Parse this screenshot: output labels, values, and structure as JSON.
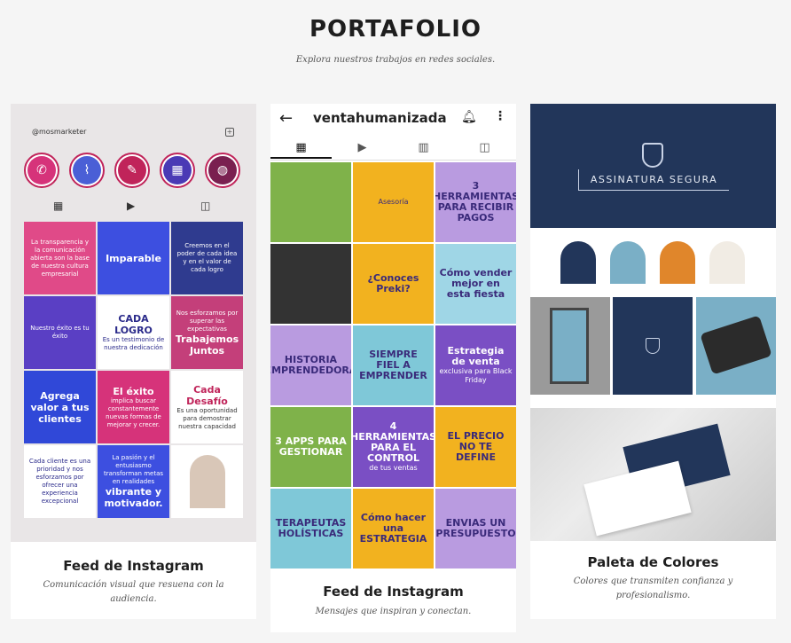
{
  "header": {
    "title": "PORTAFOLIO",
    "subtitle": "Explora nuestros trabajos en redes sociales."
  },
  "card1": {
    "handle": "@mosmarketer",
    "highlight_colors": [
      "#d6337a",
      "#4a5fd6",
      "#c0245a",
      "#4a3ab5",
      "#7a2050"
    ],
    "tiles": [
      {
        "bg": "#e04a88",
        "text": "La transparencia y la comunicación abierta son la base de nuestra cultura empresarial"
      },
      {
        "bg": "#3d4fe0",
        "text": "Imparable"
      },
      {
        "bg": "#2f3b8f",
        "text": "Creemos en el poder de cada idea y en el valor de cada logro"
      },
      {
        "bg": "#5a3fc4",
        "text": "Nuestro éxito es tu éxito"
      },
      {
        "bg": "#ffffff",
        "title": "CADA LOGRO",
        "text": "Es un testimonio de nuestra dedicación"
      },
      {
        "bg": "#c43f7a",
        "text": "Nos esforzamos por superar las expectativas",
        "title": "Trabajemos Juntos"
      },
      {
        "bg": "#3048d8",
        "title": "Agrega valor a tus clientes"
      },
      {
        "bg": "#d6337a",
        "title": "El éxito",
        "text": "implica buscar constantemente nuevas formas de mejorar y crecer."
      },
      {
        "bg": "#ffffff",
        "title": "Cada Desafío",
        "text": "Es una oportunidad para demostrar nuestra capacidad"
      },
      {
        "bg": "#ffffff",
        "text": "Cada cliente es una prioridad y nos esforzamos por ofrecer una experiencia excepcional"
      },
      {
        "bg": "#3d4fe0",
        "text": "La pasión y el entusiasmo transforman metas en realidades",
        "title": "vibrante y motivador."
      },
      {
        "bg": "#ffffff",
        "text": ""
      }
    ],
    "caption_title": "Feed de Instagram",
    "caption_desc": "Comunicación visual que resuena con la audiencia."
  },
  "card2": {
    "username": "ventahumanizada",
    "tiles": [
      {
        "bg": "#7fb24a",
        "text": ""
      },
      {
        "bg": "#f2b21f",
        "text": "Asesoría"
      },
      {
        "bg": "#b99be0",
        "title": "3 HERRAMIENTAS PARA RECIBIR PAGOS"
      },
      {
        "bg": "#333333",
        "text": ""
      },
      {
        "bg": "#f2b21f",
        "title": "¿Conoces Preki?"
      },
      {
        "bg": "#9fd6e6",
        "title": "Cómo vender mejor en esta fiesta"
      },
      {
        "bg": "#b99be0",
        "title": "HISTORIA EMPRENDEDORA"
      },
      {
        "bg": "#7fc8d8",
        "title": "SIEMPRE FIEL A EMPRENDER"
      },
      {
        "bg": "#7a4fc4",
        "title": "Estrategia de venta",
        "text": "exclusiva para Black Friday"
      },
      {
        "bg": "#7fb24a",
        "title": "3 APPS PARA GESTIONAR"
      },
      {
        "bg": "#7a4fc4",
        "title": "4 HERRAMIENTAS PARA EL CONTROL",
        "text": "de tus ventas"
      },
      {
        "bg": "#f2b21f",
        "title": "EL PRECIO NO TE DEFINE"
      },
      {
        "bg": "#7fc8d8",
        "title": "TERAPEUTAS HOLÍSTICAS"
      },
      {
        "bg": "#f2b21f",
        "title": "Cómo hacer una ESTRATEGIA"
      },
      {
        "bg": "#b99be0",
        "title": "ENVIAS UN PRESUPUESTO"
      }
    ],
    "caption_title": "Feed de Instagram",
    "caption_desc": "Mensajes que inspiran y conectan."
  },
  "card3": {
    "brand_name": "ASSINATURA SEGURA",
    "swatches": [
      "#22365a",
      "#7aafc6",
      "#e0862b",
      "#f1ece4"
    ],
    "caption_title": "Paleta de Colores",
    "caption_desc": "Colores que transmiten confianza y profesionalismo."
  }
}
